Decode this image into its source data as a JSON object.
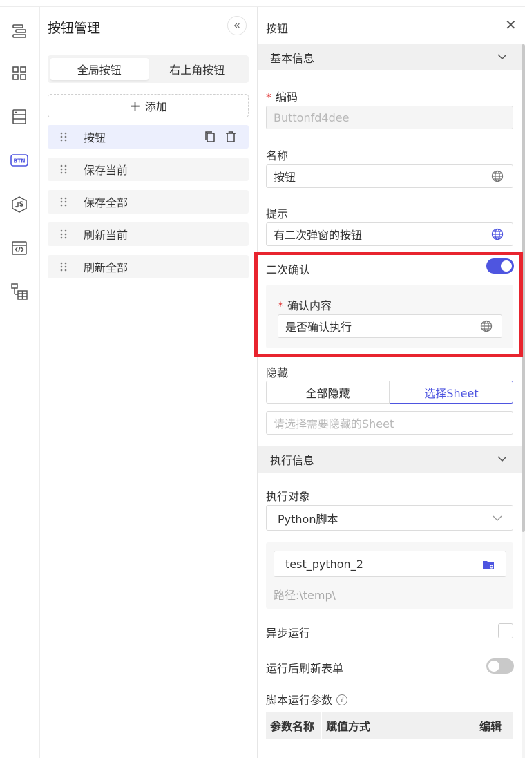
{
  "colors": {
    "accent": "#4e55e0",
    "highlight": "#e8242e",
    "required": "#e03434"
  },
  "rail": {
    "icons": [
      "layers-icon",
      "grid-icon",
      "table-icon",
      "btn-badge-icon",
      "nodejs-icon",
      "code-window-icon",
      "tree-table-icon"
    ],
    "btn_badge_text": "BTN"
  },
  "manager": {
    "title": "按钮管理",
    "tabs": [
      {
        "label": "全局按钮",
        "active": true
      },
      {
        "label": "右上角按钮",
        "active": false
      }
    ],
    "add_label": "添加",
    "items": [
      {
        "label": "按钮",
        "selected": true
      },
      {
        "label": "保存当前",
        "selected": false
      },
      {
        "label": "保存全部",
        "selected": false
      },
      {
        "label": "刷新当前",
        "selected": false
      },
      {
        "label": "刷新全部",
        "selected": false
      }
    ]
  },
  "props": {
    "title": "按钮",
    "basic_section": "基本信息",
    "code_label": "编码",
    "code_value": "Buttonfd4dee",
    "name_label": "名称",
    "name_value": "按钮",
    "hint_label": "提示",
    "hint_value": "有二次弹窗的按钮",
    "confirm_label": "二次确认",
    "confirm_enabled": true,
    "confirm_content_label": "确认内容",
    "confirm_content_value": "是否确认执行",
    "hide_label": "隐藏",
    "hide_options": [
      "全部隐藏",
      "选择Sheet"
    ],
    "hide_selected": "选择Sheet",
    "hide_sheet_placeholder": "请选择需要隐藏的Sheet",
    "exec_section": "执行信息",
    "exec_target_label": "执行对象",
    "exec_target_value": "Python脚本",
    "script_name": "test_python_2",
    "script_path": "路径:\\temp\\",
    "async_label": "异步运行",
    "async_checked": false,
    "refresh_label": "运行后刷新表单",
    "refresh_enabled": false,
    "params_label": "脚本运行参数",
    "params_help": "?",
    "params_columns": [
      "参数名称",
      "赋值方式",
      "编辑"
    ]
  }
}
